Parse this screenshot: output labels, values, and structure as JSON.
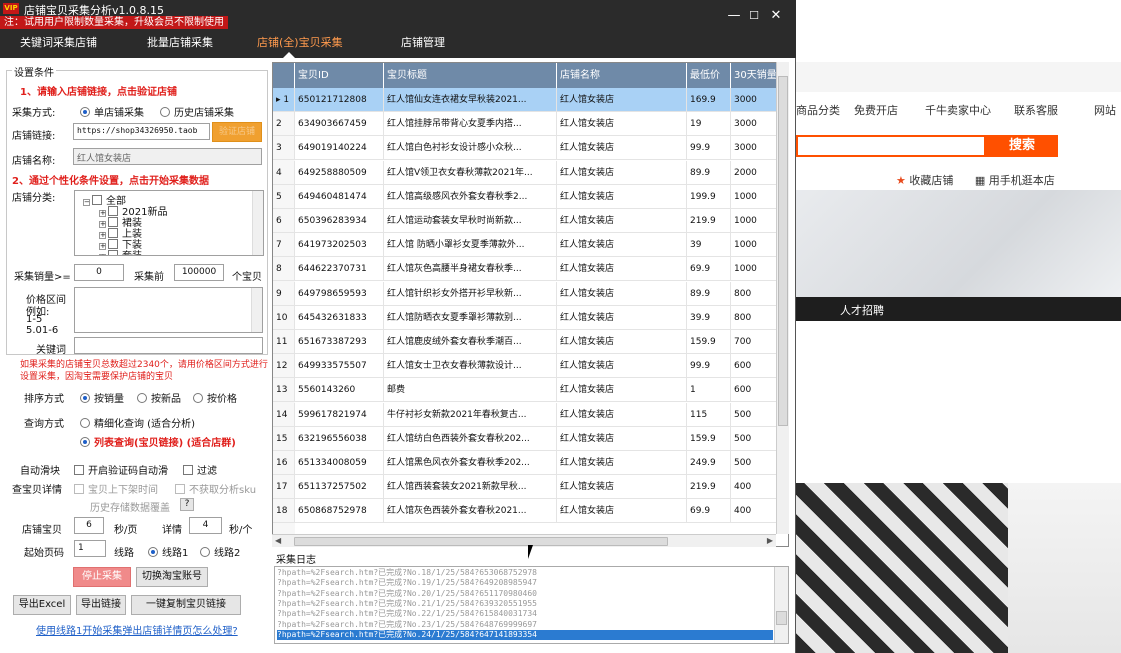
{
  "app": {
    "title": "店铺宝贝采集分析v1.0.8.15",
    "vip_badge": "VIP",
    "notice": "注：试用用户限制数量采集，升级会员不限制使用",
    "win_min": "—",
    "win_max": "☐",
    "win_close": "✕"
  },
  "tabs": [
    {
      "label": "关键词采集店铺"
    },
    {
      "label": "批量店铺采集"
    },
    {
      "label": "店铺(全)宝贝采集"
    },
    {
      "label": "店铺管理"
    }
  ],
  "settings": {
    "group_title": "设置条件",
    "step1": "1、请输入店铺链接，点击验证店铺",
    "mode_label": "采集方式:",
    "mode_single": "单店铺采集",
    "mode_history": "历史店铺采集",
    "link_label": "店铺链接:",
    "link_value": "https://shop34326950.taob",
    "verify_btn": "验证店铺",
    "name_label": "店铺名称:",
    "name_value": "红人馆女装店",
    "step2": "2、通过个性化条件设置，点击开始采集数据",
    "category_label": "店铺分类:",
    "categories": [
      "全部",
      "2021新品",
      "裙装",
      "上装",
      "下装",
      "套装"
    ],
    "sales_label": "采集销量>=",
    "sales_value": "0",
    "first_label": "采集前",
    "first_value": "100000",
    "first_unit": "个宝贝",
    "price_label": "价格区间",
    "price_hint1": "例如:",
    "price_hint2": "1-5",
    "price_hint3": "5.01-6",
    "keyword_label": "关键词",
    "warn": "如果采集的店铺宝贝总数超过2340个，请用价格区间方式进行设置采集，因淘宝需要保护店铺的宝贝",
    "sort_label": "排序方式",
    "sort_sales": "按销量",
    "sort_new": "按新品",
    "sort_price": "按价格",
    "query_label": "查询方式",
    "query_fine": "精细化查询 (适合分析)",
    "query_list": "列表查询(宝贝链接) (适合店群)",
    "slide_label": "自动滑块",
    "slide_auto": "开启验证码自动滑",
    "slide_filter": "过滤",
    "detail_label": "查宝贝详情",
    "detail_opt1": "宝贝上下架时间",
    "detail_opt2": "不获取分析sku",
    "history_link": "历史存储数据覆盖",
    "history_help": "?",
    "shop_label": "店铺宝贝",
    "shop_sec": "6",
    "shop_unit": "秒/页",
    "detail_sec_label": "详情",
    "detail_sec": "4",
    "detail_unit": "秒/个",
    "start_page_label": "起始页码",
    "start_page": "1",
    "line_label": "线路",
    "line1": "线路1",
    "line2": "线路2",
    "stop_btn": "停止采集",
    "switch_btn": "切换淘宝账号",
    "export_excel": "导出Excel",
    "export_link": "导出链接",
    "copy_btn": "一键复制宝贝链接",
    "help_link": "使用线路1开始采集弹出店铺详情页怎么处理?"
  },
  "grid": {
    "columns": [
      "宝贝ID",
      "宝贝标题",
      "店铺名称",
      "最低价",
      "30天销量"
    ],
    "rows": [
      {
        "n": "1",
        "id": "650121712808",
        "title": "红人馆仙女连衣裙女早秋装2021...",
        "shop": "红人馆女装店",
        "price": "169.9",
        "sales": "3000"
      },
      {
        "n": "2",
        "id": "634903667459",
        "title": "红人馆挂脖吊带背心女夏季内搭...",
        "shop": "红人馆女装店",
        "price": "19",
        "sales": "3000"
      },
      {
        "n": "3",
        "id": "649019140224",
        "title": "红人馆白色衬衫女设计感小众秋...",
        "shop": "红人馆女装店",
        "price": "99.9",
        "sales": "3000"
      },
      {
        "n": "4",
        "id": "649258880509",
        "title": "红人馆V领卫衣女春秋薄款2021年...",
        "shop": "红人馆女装店",
        "price": "89.9",
        "sales": "2000"
      },
      {
        "n": "5",
        "id": "649460481474",
        "title": "红人馆高级感风衣外套女春秋季2...",
        "shop": "红人馆女装店",
        "price": "199.9",
        "sales": "1000"
      },
      {
        "n": "6",
        "id": "650396283934",
        "title": "红人馆运动套装女早秋时尚新款...",
        "shop": "红人馆女装店",
        "price": "219.9",
        "sales": "1000"
      },
      {
        "n": "7",
        "id": "641973202503",
        "title": "红人馆 防晒小罩衫女夏季薄款外...",
        "shop": "红人馆女装店",
        "price": "39",
        "sales": "1000"
      },
      {
        "n": "8",
        "id": "644622370731",
        "title": "红人馆灰色高腰半身裙女春秋季...",
        "shop": "红人馆女装店",
        "price": "69.9",
        "sales": "1000"
      },
      {
        "n": "9",
        "id": "649798659593",
        "title": "红人馆针织衫女外搭开衫早秋新...",
        "shop": "红人馆女装店",
        "price": "89.9",
        "sales": "800"
      },
      {
        "n": "10",
        "id": "645432631833",
        "title": "红人馆防晒衣女夏季罩衫薄款别...",
        "shop": "红人馆女装店",
        "price": "39.9",
        "sales": "800"
      },
      {
        "n": "11",
        "id": "651673387293",
        "title": "红人馆鹿皮绒外套女春秋季潮百...",
        "shop": "红人馆女装店",
        "price": "159.9",
        "sales": "700"
      },
      {
        "n": "12",
        "id": "649933575507",
        "title": "红人馆女士卫衣女春秋薄款设计...",
        "shop": "红人馆女装店",
        "price": "99.9",
        "sales": "600"
      },
      {
        "n": "13",
        "id": "5560143260",
        "title": "邮费",
        "shop": "红人馆女装店",
        "price": "1",
        "sales": "600"
      },
      {
        "n": "14",
        "id": "599617821974",
        "title": "牛仔衬衫女新款2021年春秋复古...",
        "shop": "红人馆女装店",
        "price": "115",
        "sales": "500"
      },
      {
        "n": "15",
        "id": "632196556038",
        "title": "红人馆纺白色西装外套女春秋202...",
        "shop": "红人馆女装店",
        "price": "159.9",
        "sales": "500"
      },
      {
        "n": "16",
        "id": "651334008059",
        "title": "红人馆黑色风衣外套女春秋季202...",
        "shop": "红人馆女装店",
        "price": "249.9",
        "sales": "500"
      },
      {
        "n": "17",
        "id": "651137257502",
        "title": "红人馆西装套装女2021新款早秋...",
        "shop": "红人馆女装店",
        "price": "219.9",
        "sales": "400"
      },
      {
        "n": "18",
        "id": "650868752978",
        "title": "红人馆灰色西装外套女春秋2021...",
        "shop": "红人馆女装店",
        "price": "69.9",
        "sales": "400"
      }
    ]
  },
  "log": {
    "title": "采集日志",
    "lines": [
      "?hpath=%2Fsearch.htm?已完成?No.18/1/25/584?653068752978",
      "?hpath=%2Fsearch.htm?已完成?No.19/1/25/584?649208985947",
      "?hpath=%2Fsearch.htm?已完成?No.20/1/25/584?651170980460",
      "?hpath=%2Fsearch.htm?已完成?No.21/1/25/584?639320551955",
      "?hpath=%2Fsearch.htm?已完成?No.22/1/25/584?615840031734",
      "?hpath=%2Fsearch.htm?已完成?No.23/1/25/584?648769999697",
      "?hpath=%2Fsearch.htm?已完成?No.24/1/25/584?647141893354"
    ]
  },
  "background_page": {
    "nav": [
      "商品分类",
      "免费开店",
      "千牛卖家中心",
      "联系客服",
      "网站"
    ],
    "search_btn": "搜索",
    "fav": "收藏店铺",
    "mobile": "用手机逛本店",
    "recruit": "人才招聘"
  }
}
